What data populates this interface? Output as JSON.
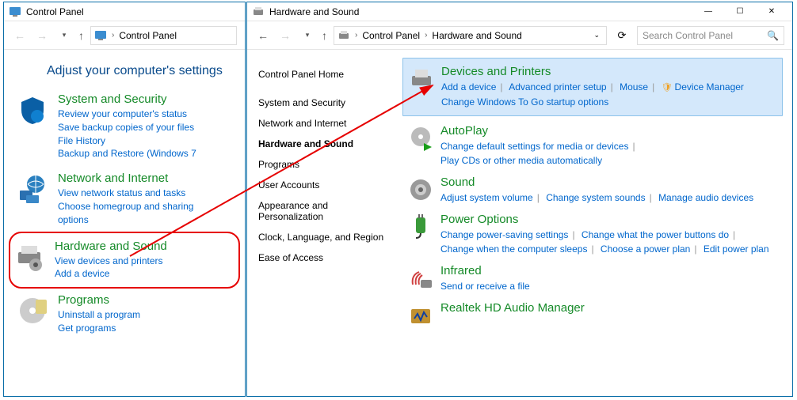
{
  "window1": {
    "title": "Control Panel",
    "breadcrumb": [
      "Control Panel"
    ],
    "heading": "Adjust your computer's settings",
    "categories": [
      {
        "title": "System and Security",
        "links": [
          "Review your computer's status",
          "Save backup copies of your files",
          "File History",
          "Backup and Restore (Windows 7"
        ]
      },
      {
        "title": "Network and Internet",
        "links": [
          "View network status and tasks",
          "Choose homegroup and sharing",
          "options"
        ]
      },
      {
        "title": "Hardware and Sound",
        "links": [
          "View devices and printers",
          "Add a device"
        ],
        "highlighted": true
      },
      {
        "title": "Programs",
        "links": [
          "Uninstall a program",
          "Get programs"
        ]
      }
    ]
  },
  "window2": {
    "title": "Hardware and Sound",
    "breadcrumb": [
      "Control Panel",
      "Hardware and Sound"
    ],
    "search_placeholder": "Search Control Panel",
    "sidebar": [
      {
        "label": "Control Panel Home",
        "bold": false
      },
      {
        "label": "System and Security",
        "bold": false
      },
      {
        "label": "Network and Internet",
        "bold": false
      },
      {
        "label": "Hardware and Sound",
        "bold": true
      },
      {
        "label": "Programs",
        "bold": false
      },
      {
        "label": "User Accounts",
        "bold": false
      },
      {
        "label": "Appearance and Personalization",
        "bold": false
      },
      {
        "label": "Clock, Language, and Region",
        "bold": false
      },
      {
        "label": "Ease of Access",
        "bold": false
      }
    ],
    "sections": [
      {
        "title": "Devices and Printers",
        "selected": true,
        "links": [
          "Add a device",
          "Advanced printer setup",
          "Mouse",
          "Device Manager"
        ],
        "shield_index": 3,
        "extra": [
          "Change Windows To Go startup options"
        ]
      },
      {
        "title": "AutoPlay",
        "links": [
          "Change default settings for media or devices"
        ],
        "extra": [
          "Play CDs or other media automatically"
        ]
      },
      {
        "title": "Sound",
        "links": [
          "Adjust system volume",
          "Change system sounds",
          "Manage audio devices"
        ]
      },
      {
        "title": "Power Options",
        "links": [
          "Change power-saving settings",
          "Change what the power buttons do"
        ],
        "extra_links": [
          "Change when the computer sleeps",
          "Choose a power plan",
          "Edit power plan"
        ]
      },
      {
        "title": "Infrared",
        "links": [
          "Send or receive a file"
        ]
      },
      {
        "title": "Realtek HD Audio Manager",
        "links": []
      }
    ]
  }
}
